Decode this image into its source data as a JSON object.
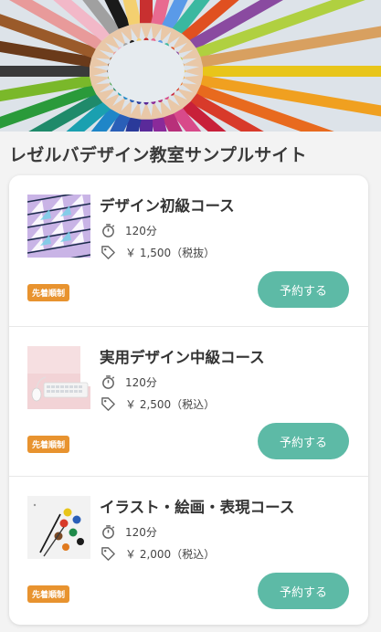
{
  "site": {
    "title": "レゼルバデザイン教室サンプルサイト"
  },
  "hero": {
    "icon": "colored-pencils-photo"
  },
  "courses": [
    {
      "name": "デザイン初級コース",
      "duration": "120分",
      "price": "￥ 1,500（税抜）",
      "badge": "先着順制",
      "button": "予約する",
      "thumb": "triangle-pattern-image"
    },
    {
      "name": "実用デザイン中級コース",
      "duration": "120分",
      "price": "￥ 2,500（税込）",
      "badge": "先着順制",
      "button": "予約する",
      "thumb": "keyboard-desk-image"
    },
    {
      "name": "イラスト・絵画・表現コース",
      "duration": "120分",
      "price": "￥ 2,000（税込）",
      "badge": "先着順制",
      "button": "予約する",
      "thumb": "paint-palette-image"
    }
  ],
  "colors": {
    "accent": "#5dbaa6",
    "badge": "#e8932f",
    "background": "#f3f3f3"
  }
}
